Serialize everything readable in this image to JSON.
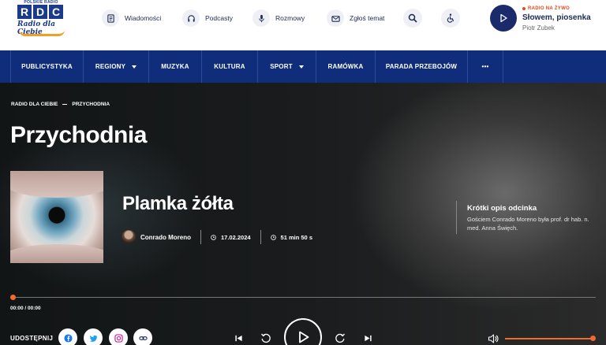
{
  "logo": {
    "top": "POLSKIE RADIO",
    "letters": [
      "R",
      "D",
      "C"
    ],
    "script": "Radio dla Ciebie"
  },
  "header_nav": [
    {
      "label": "Wiadomości",
      "icon": "document-icon"
    },
    {
      "label": "Podcasty",
      "icon": "headphones-icon"
    },
    {
      "label": "Rozmowy",
      "icon": "microphone-icon"
    },
    {
      "label": "Zgłoś temat",
      "icon": "mail-icon"
    }
  ],
  "live": {
    "label": "RADIO NA ŻYWO",
    "title": "Słowem, piosenka",
    "author": "Piotr Zubek"
  },
  "main_nav": [
    "PUBLICYSTYKA",
    "REGIONY",
    "MUZYKA",
    "KULTURA",
    "SPORT",
    "RAMÓWKA",
    "PARADA PRZEBOJÓW",
    "•••"
  ],
  "breadcrumb": [
    "RADIO DLA CIEBIE",
    "PRZYCHODNIA"
  ],
  "page_title": "Przychodnia",
  "episode": {
    "title": "Plamka żółta",
    "author": "Conrado Moreno",
    "date": "17.02.2024",
    "duration": "51 min 50 s"
  },
  "description": {
    "heading": "Krótki opis odcinka",
    "text": "Gościem Conrado Moreno była prof. dr hab. n. med. Anna Święch."
  },
  "player": {
    "time": "00:00 / 00:00",
    "progress": 0,
    "volume": 1.0,
    "accent": "#f26a2e"
  },
  "share": {
    "label": "UDOSTĘPNIJ",
    "icons": [
      "facebook-icon",
      "twitter-icon",
      "instagram-icon",
      "link-icon"
    ]
  }
}
